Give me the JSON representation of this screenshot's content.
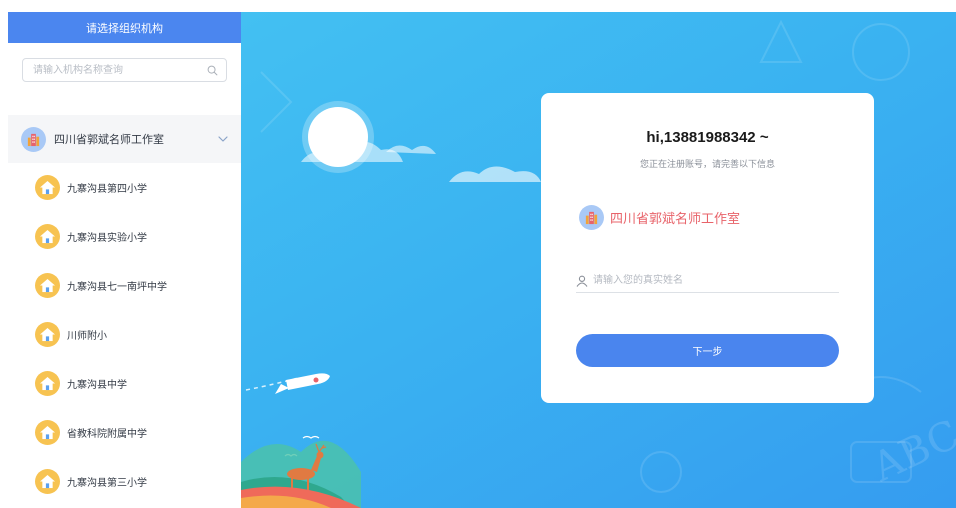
{
  "sidebar": {
    "header": "请选择组织机构",
    "search": {
      "placeholder": "请输入机构名称查询",
      "value": ""
    },
    "parent": {
      "label": "四川省郭斌名师工作室",
      "icon": "building-icon",
      "expanded": true
    },
    "items": [
      {
        "label": "九寨沟县第四小学",
        "icon": "school-icon"
      },
      {
        "label": "九寨沟县实验小学",
        "icon": "school-icon"
      },
      {
        "label": "九寨沟县七一南坪中学",
        "icon": "school-icon"
      },
      {
        "label": "川师附小",
        "icon": "school-icon"
      },
      {
        "label": "九寨沟县中学",
        "icon": "school-icon"
      },
      {
        "label": "省教科院附属中学",
        "icon": "school-icon"
      },
      {
        "label": "九寨沟县第三小学",
        "icon": "school-icon"
      }
    ]
  },
  "card": {
    "title": "hi,13881988342 ~",
    "subtitle": "您正在注册账号，请完善以下信息",
    "org_name": "四川省郭斌名师工作室",
    "name_input": {
      "placeholder": "请输入您的真实姓名",
      "value": ""
    },
    "next_button": "下一步"
  },
  "colors": {
    "primary": "#4a85ee",
    "org_name": "#e8636a",
    "school_badge": "#f7c351",
    "building_badge": "#a9c9f6",
    "background_gradient": [
      "#43c0f2",
      "#359cf0"
    ]
  }
}
